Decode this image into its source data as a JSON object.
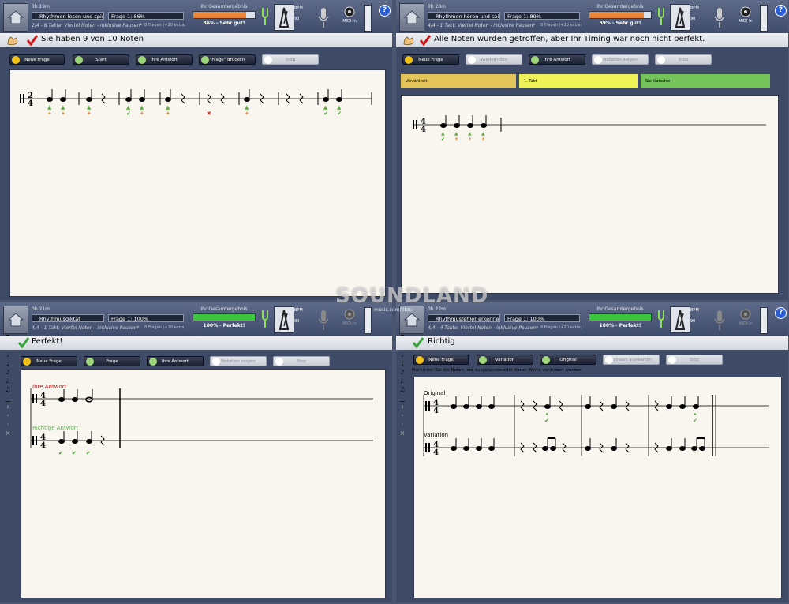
{
  "watermark": {
    "brand": "SOUNDLAND",
    "sub": "music.com/tibru"
  },
  "panels": [
    {
      "time": "0h 19m",
      "mode": "Rhythmen lesen und spielen",
      "frage": "Frage 1: 86%",
      "desc": "2/4 - 8 Takte: Viertel Noten - inklusive Pausen*",
      "extra": "8 Fragen (+20 extra)",
      "result_label": "Ihr Gesamtergebnis",
      "result_value": "86% - Sehr gut!",
      "result_pct": 86,
      "bar_color": "#e8863a",
      "bpm_label": "BPM",
      "bpm": "90",
      "midi_label": "MIDI-In",
      "help": "?",
      "feedback": "Sie haben 9 von 10 Noten",
      "buttons": [
        "Neue Frage",
        "Start",
        "Ihre Antwort",
        "\"Frage\" drücken",
        "Stop"
      ]
    },
    {
      "time": "0h 20m",
      "mode": "Rhythmen hören und spielen",
      "frage": "Frage 1: 89%",
      "desc": "4/4 - 1 Takt: Viertel Noten - inklusive Pausen*",
      "extra": "8 Fragen (+20 extra)",
      "result_label": "Ihr Gesamtergebnis",
      "result_value": "89% - Sehr gut!",
      "result_pct": 89,
      "bar_color": "#e8863a",
      "bpm_label": "BPM",
      "bpm": "90",
      "midi_label": "MIDI-In",
      "help": "?",
      "feedback": "Alle Noten wurden getroffen, aber Ihr Timing war noch nicht perfekt.",
      "buttons": [
        "Neue Frage",
        "Wiederholen",
        "Ihre Antwort",
        "Notation zeigen",
        "Stop"
      ],
      "stages": [
        {
          "label": "Vorzählzeit",
          "color": "#e2c458"
        },
        {
          "label": "1. Takt",
          "color": "#f0f25a"
        },
        {
          "label": "Sie klatschen",
          "color": "#74c35a"
        }
      ]
    },
    {
      "time": "0h 21m",
      "mode": "Rhythmusdiktat",
      "frage": "Frage 1: 100%",
      "desc": "4/4 - 1 Takt: Viertel Noten - inklusive Pausen*",
      "extra": "8 Fragen (+20 extra)",
      "result_label": "Ihr Gesamtergebnis",
      "result_value": "100% - Perfekt!",
      "result_pct": 100,
      "bar_color": "#3cc43c",
      "bpm_label": "BPM",
      "bpm": "90",
      "midi_label": "MIDI-In",
      "help": "?",
      "feedback": "Perfekt!",
      "buttons": [
        "Neue Frage",
        "Frage",
        "Ihre Antwort",
        "Notation zeigen",
        "Stop"
      ],
      "staff_labels": [
        "Ihre Antwort",
        "Richtige Antwort"
      ]
    },
    {
      "time": "0h 22m",
      "mode": "Rhythmusfehler erkennen",
      "frage": "Frage 1: 100%",
      "desc": "4/4 - 4 Takte: Viertel Noten - inklusive Pausen*",
      "extra": "8 Fragen (+20 extra)",
      "result_label": "Ihr Gesamtergebnis",
      "result_value": "100% - Perfekt!",
      "result_pct": 100,
      "bar_color": "#3cc43c",
      "bpm_label": "BPM",
      "bpm": "90",
      "midi_label": "MIDI-In",
      "help": "?",
      "feedback": "Richtig",
      "buttons": [
        "Neue Frage",
        "Variation",
        "Original",
        "Antwort auswerten",
        "Stop"
      ],
      "instruction": "Markieren Sie die Noten, die ausgelassen oder deren Werte verändert wurden",
      "staff_labels": [
        "Original",
        "Variation"
      ]
    }
  ]
}
